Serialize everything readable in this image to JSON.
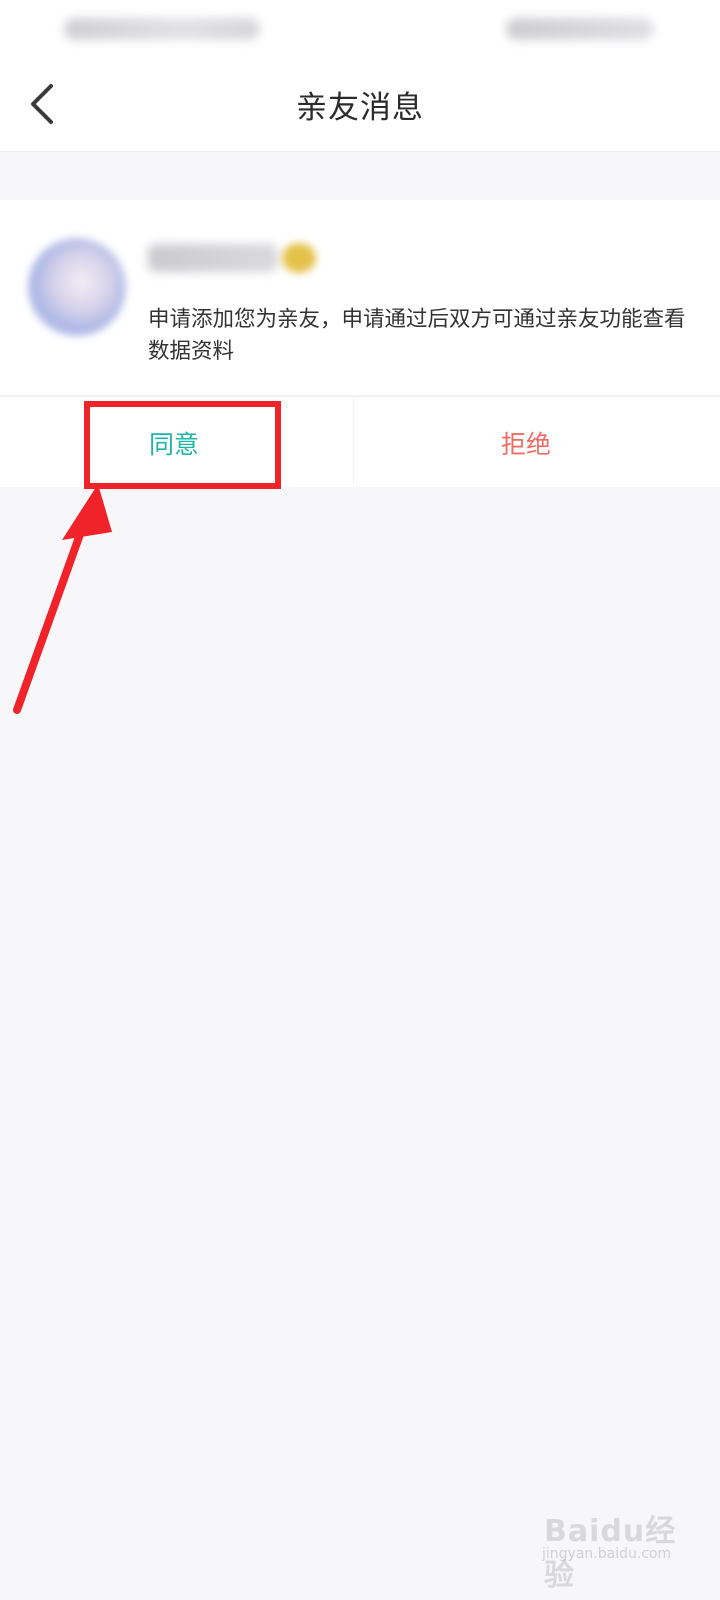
{
  "nav": {
    "title": "亲友消息",
    "back_icon": "chevron-left-icon"
  },
  "request": {
    "message": "申请添加您为亲友，申请通过后双方可通过亲友功能查看数据资料"
  },
  "actions": {
    "agree_label": "同意",
    "reject_label": "拒绝"
  },
  "colors": {
    "agree": "#1fb5a8",
    "reject": "#ef6b63",
    "highlight": "#f0232a",
    "background": "#f7f7f9"
  },
  "watermark": {
    "brand": "Baidu经验",
    "domain": "jingyan.baidu.com"
  }
}
